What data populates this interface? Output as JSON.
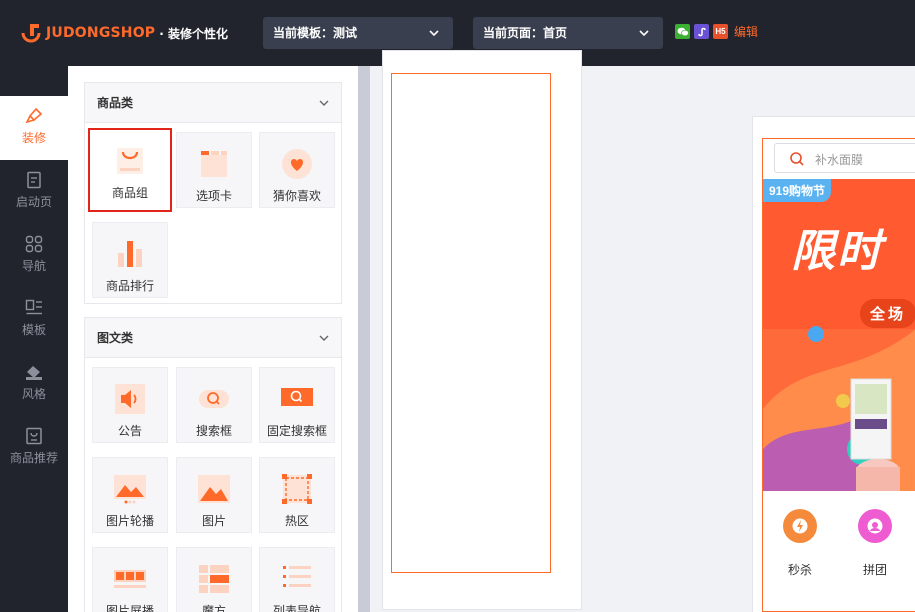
{
  "header": {
    "brand": "JUDONGSHOP",
    "brand_sub": "· 装修个性化",
    "template_select": "当前模板：测试",
    "page_select": "当前页面：首页",
    "platforms": [
      "wechat-icon",
      "miniprogram-icon",
      "h5-icon"
    ],
    "h5_label": "H5",
    "edit_label": "编辑"
  },
  "nav": {
    "items": [
      {
        "label": "装修",
        "icon": "brush-icon",
        "active": true
      },
      {
        "label": "启动页",
        "icon": "document-icon"
      },
      {
        "label": "导航",
        "icon": "grid-icon"
      },
      {
        "label": "模板",
        "icon": "template-icon"
      },
      {
        "label": "风格",
        "icon": "paint-bucket-icon"
      },
      {
        "label": "商品推荐",
        "icon": "recommend-icon"
      }
    ]
  },
  "panel": {
    "groups": [
      {
        "title": "商品类",
        "items": [
          {
            "label": "商品组",
            "icon": "basket-icon",
            "selected": true
          },
          {
            "label": "选项卡",
            "icon": "tabs-icon"
          },
          {
            "label": "猜你喜欢",
            "icon": "heart-icon"
          },
          {
            "label": "商品排行",
            "icon": "ranking-icon"
          }
        ]
      },
      {
        "title": "图文类",
        "items": [
          {
            "label": "公告",
            "icon": "speaker-icon"
          },
          {
            "label": "搜索框",
            "icon": "search-box-icon"
          },
          {
            "label": "固定搜索框",
            "icon": "fixed-search-icon"
          },
          {
            "label": "图片轮播",
            "icon": "carousel-icon"
          },
          {
            "label": "图片",
            "icon": "image-icon"
          },
          {
            "label": "热区",
            "icon": "hotspot-icon"
          },
          {
            "label": "图片屏播",
            "icon": "image-screen-icon"
          },
          {
            "label": "魔方",
            "icon": "cube-icon"
          },
          {
            "label": "列表导航",
            "icon": "list-nav-icon"
          }
        ]
      }
    ]
  },
  "preview": {
    "search_placeholder": "补水面膜",
    "banner_tag": "919购物节",
    "banner_title": "限时",
    "banner_pill": "全场",
    "quick_links": [
      {
        "label": "秒杀",
        "icon": "flash-sale-icon"
      },
      {
        "label": "拼团",
        "icon": "group-buy-icon"
      }
    ]
  },
  "colors": {
    "accent": "#ff6a2a",
    "topbar": "#21242d",
    "selected_border": "#e1251b"
  }
}
